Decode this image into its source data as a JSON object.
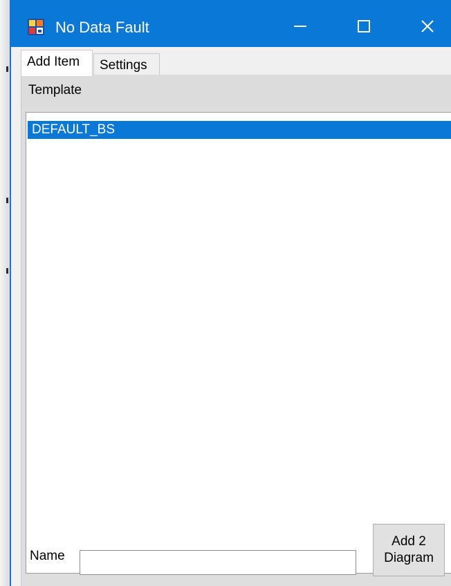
{
  "window": {
    "title": "No Data Fault",
    "app_icon": "app-window-icon",
    "controls": {
      "minimize_icon": "minimize-icon",
      "maximize_icon": "maximize-icon",
      "close_icon": "close-icon"
    },
    "accent_color": "#0a78d7"
  },
  "tabs": [
    {
      "label": "Add Item",
      "active": true
    },
    {
      "label": "Settings",
      "active": false
    }
  ],
  "template": {
    "label": "Template",
    "items": [
      {
        "text": "DEFAULT_BS",
        "selected": true
      }
    ]
  },
  "name_field": {
    "label": "Name",
    "value": "",
    "placeholder": ""
  },
  "add_button": {
    "line1": "Add 2",
    "line2": "Diagram"
  }
}
